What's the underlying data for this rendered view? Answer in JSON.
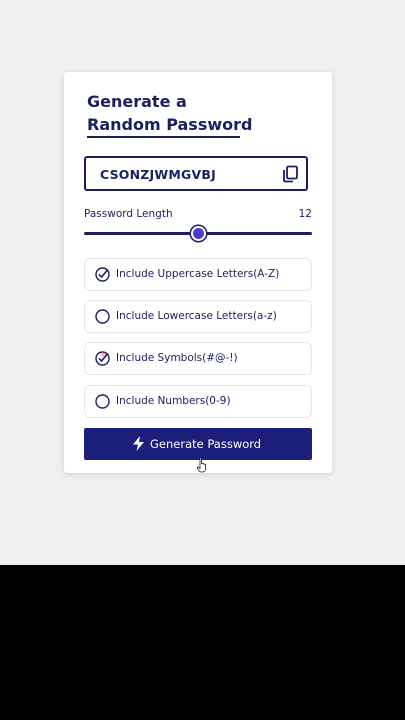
{
  "card": {
    "title_line1": "Generate a",
    "title_line2": "Random Password"
  },
  "password": {
    "value": "CSONZJWMGVBJ",
    "copy_icon": "copy-icon"
  },
  "length": {
    "label": "Password Length",
    "value": "12",
    "slider_fraction": 0.5
  },
  "options": [
    {
      "label": "Include Uppercase Letters(A-Z)",
      "checked": true
    },
    {
      "label": "Include Lowercase Letters(a-z)",
      "checked": false
    },
    {
      "label": "Include Symbols(#@-!)",
      "checked": true
    },
    {
      "label": "Include Numbers(0-9)",
      "checked": false
    }
  ],
  "generate": {
    "label": "Generate Password",
    "icon": "bolt-icon"
  },
  "colors": {
    "navy": "#1b1f5e",
    "button": "#1b1f7a",
    "thumb": "#4a3cc8",
    "background": "#efefef"
  }
}
